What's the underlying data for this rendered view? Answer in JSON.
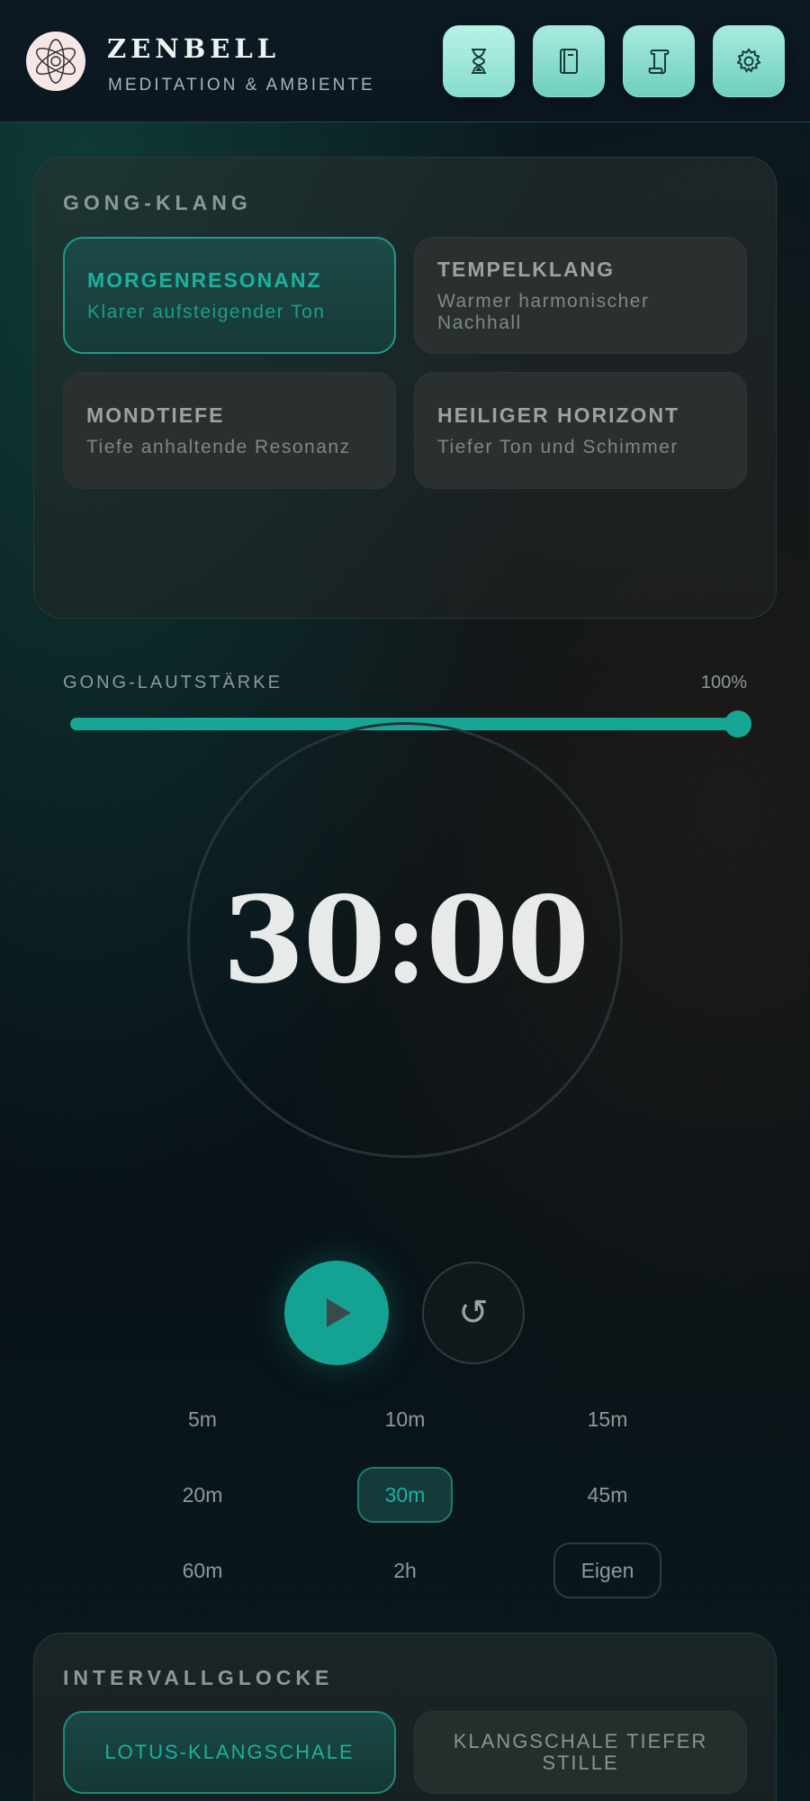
{
  "header": {
    "title": "ZENBELL",
    "subtitle": "MEDITATION & AMBIENTE",
    "buttons": [
      {
        "icon": "hourglass-icon",
        "active": true
      },
      {
        "icon": "book-icon",
        "active": false
      },
      {
        "icon": "scroll-icon",
        "active": false
      },
      {
        "icon": "gear-icon",
        "active": false
      }
    ]
  },
  "gong": {
    "title": "GONG-KLANG",
    "options": [
      {
        "name": "MORGENRESONANZ",
        "desc": "Klarer aufsteigender Ton",
        "selected": true
      },
      {
        "name": "TEMPELKLANG",
        "desc": "Warmer harmonischer Nachhall",
        "selected": false
      },
      {
        "name": "MONDTIEFE",
        "desc": "Tiefe anhaltende Resonanz",
        "selected": false
      },
      {
        "name": "HEILIGER HORIZONT",
        "desc": "Tiefer Ton und Schimmer",
        "selected": false
      }
    ],
    "volume_label": "GONG-LAUTSTÄRKE",
    "volume_value": "100%",
    "volume_fraction": 1.0
  },
  "timer": {
    "display": "30:00",
    "reset_symbol": "↺"
  },
  "durations": [
    {
      "label": "5m",
      "selected": false
    },
    {
      "label": "10m",
      "selected": false
    },
    {
      "label": "15m",
      "selected": false
    },
    {
      "label": "20m",
      "selected": false
    },
    {
      "label": "30m",
      "selected": true
    },
    {
      "label": "45m",
      "selected": false
    },
    {
      "label": "60m",
      "selected": false
    },
    {
      "label": "2h",
      "selected": false
    },
    {
      "label": "Eigen",
      "selected": false
    }
  ],
  "interval": {
    "title": "INTERVALLGLOCKE",
    "options": [
      {
        "name": "LOTUS-KLANGSCHALE",
        "selected": true
      },
      {
        "name": "KLANGSCHALE TIEFER STILLE",
        "selected": false
      }
    ]
  },
  "colors": {
    "accent": "#18a694",
    "header_button": "#8fe0d2"
  }
}
